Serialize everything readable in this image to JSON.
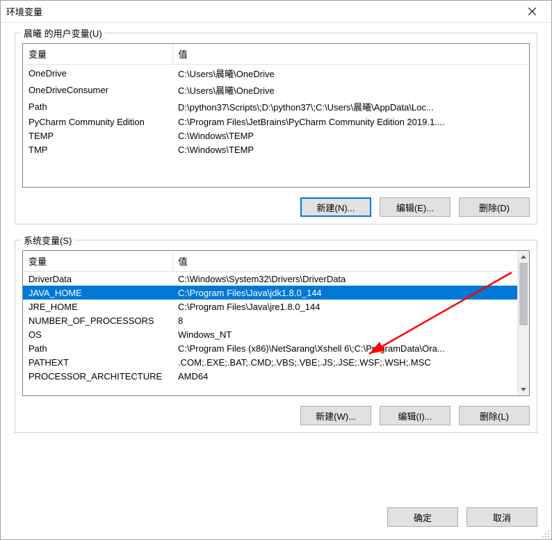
{
  "window": {
    "title": "环境变量"
  },
  "user_section": {
    "title": "晨曦 的用户变量(U)",
    "headers": {
      "var": "变量",
      "val": "值"
    },
    "rows": [
      {
        "var": "OneDrive",
        "val": "C:\\Users\\晨曦\\OneDrive"
      },
      {
        "var": "OneDriveConsumer",
        "val": "C:\\Users\\晨曦\\OneDrive"
      },
      {
        "var": "Path",
        "val": "D:\\python37\\Scripts\\;D:\\python37\\;C:\\Users\\晨曦\\AppData\\Loc..."
      },
      {
        "var": "PyCharm Community Edition",
        "val": "C:\\Program Files\\JetBrains\\PyCharm Community Edition 2019.1...."
      },
      {
        "var": "TEMP",
        "val": "C:\\Windows\\TEMP"
      },
      {
        "var": "TMP",
        "val": "C:\\Windows\\TEMP"
      }
    ],
    "buttons": {
      "new": "新建(N)...",
      "edit": "编辑(E)...",
      "del": "删除(D)"
    }
  },
  "sys_section": {
    "title": "系统变量(S)",
    "headers": {
      "var": "变量",
      "val": "值"
    },
    "rows": [
      {
        "var": "DriverData",
        "val": "C:\\Windows\\System32\\Drivers\\DriverData",
        "sel": false
      },
      {
        "var": "JAVA_HOME",
        "val": "C:\\Program Files\\Java\\jdk1.8.0_144",
        "sel": true
      },
      {
        "var": "JRE_HOME",
        "val": "C:\\Program Files\\Java\\jre1.8.0_144",
        "sel": false
      },
      {
        "var": "NUMBER_OF_PROCESSORS",
        "val": "8",
        "sel": false
      },
      {
        "var": "OS",
        "val": "Windows_NT",
        "sel": false
      },
      {
        "var": "Path",
        "val": "C:\\Program Files (x86)\\NetSarang\\Xshell 6\\;C:\\ProgramData\\Ora...",
        "sel": false
      },
      {
        "var": "PATHEXT",
        "val": ".COM;.EXE;.BAT;.CMD;.VBS;.VBE;.JS;.JSE;.WSF;.WSH;.MSC",
        "sel": false
      },
      {
        "var": "PROCESSOR_ARCHITECTURE",
        "val": "AMD64",
        "sel": false
      }
    ],
    "buttons": {
      "new": "新建(W)...",
      "edit": "编辑(I)...",
      "del": "删除(L)"
    }
  },
  "dialog_buttons": {
    "ok": "确定",
    "cancel": "取消"
  }
}
